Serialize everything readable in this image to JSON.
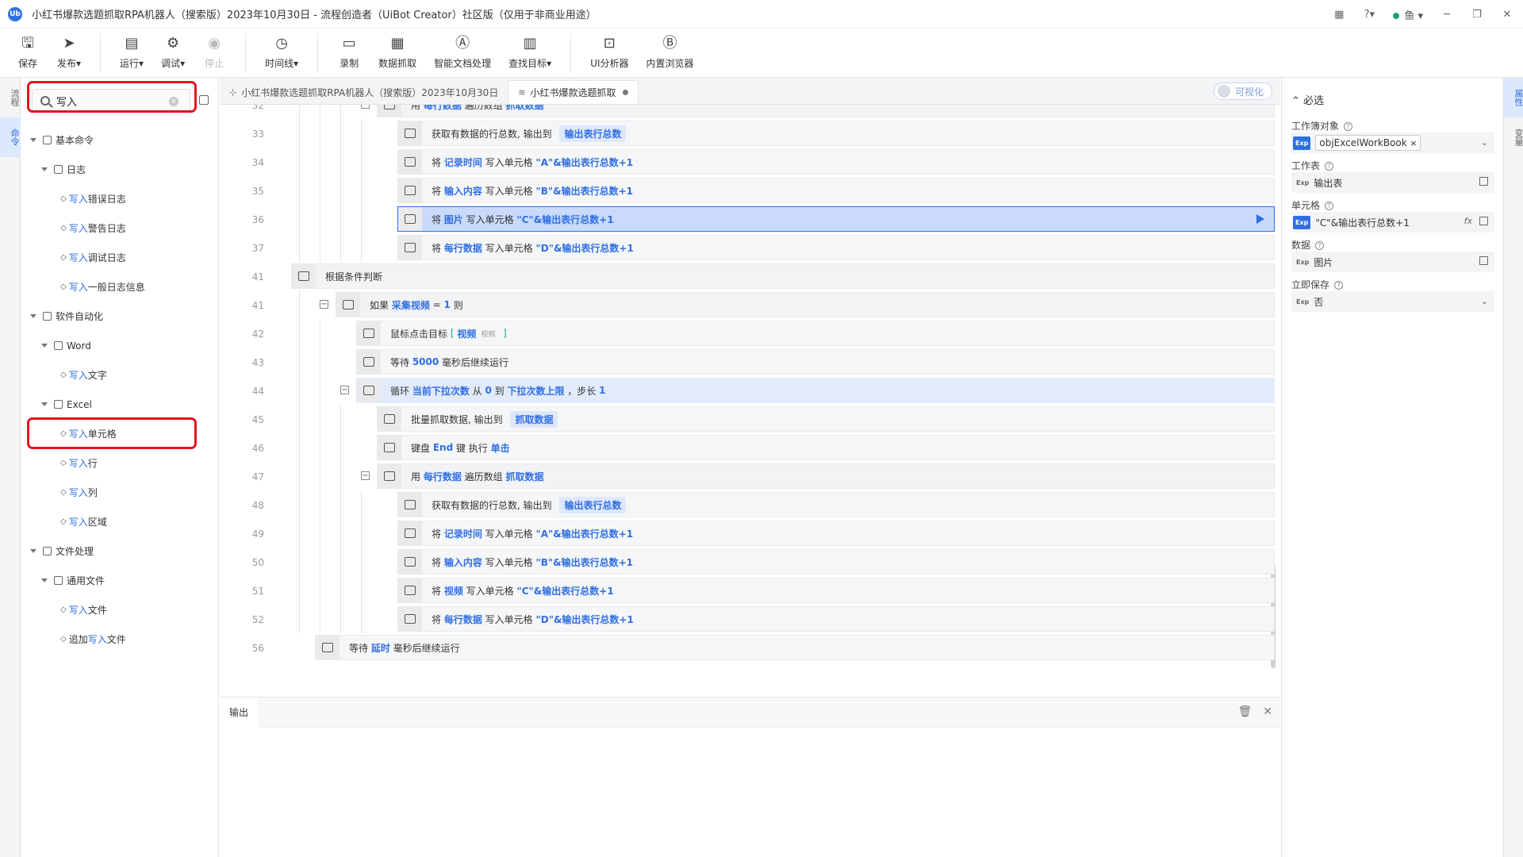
{
  "window": {
    "title": "小红书爆款选题抓取RPA机器人（搜索版）2023年10月30日 - 流程创造者（UiBot Creator）社区版（仅用于非商业用途）",
    "logo": "Ub",
    "user": "鱼",
    "accent": "#2f6fe4"
  },
  "toolbar": {
    "items": [
      {
        "label": "保存",
        "icon": "save-icon"
      },
      {
        "label": "发布▾",
        "icon": "send-icon"
      },
      {
        "label": "运行▾",
        "icon": "run-icon"
      },
      {
        "label": "调试▾",
        "icon": "debug-icon"
      },
      {
        "label": "停止",
        "icon": "stop-icon"
      },
      {
        "label": "时间线▾",
        "icon": "clock-icon"
      },
      {
        "label": "录制",
        "icon": "record-icon"
      },
      {
        "label": "数据抓取",
        "icon": "data-capture-icon"
      },
      {
        "label": "智能文档处理",
        "icon": "ai-doc-icon"
      },
      {
        "label": "查找目标▾",
        "icon": "find-target-icon"
      },
      {
        "label": "UI分析器",
        "icon": "ui-analyzer-icon"
      },
      {
        "label": "内置浏览器",
        "icon": "browser-icon"
      }
    ]
  },
  "left_strip": {
    "tabs": [
      "流程",
      "命令"
    ]
  },
  "right_strip": {
    "tabs": [
      "属性",
      "变量"
    ]
  },
  "commands": {
    "search_value": "写入",
    "tree": [
      {
        "level": 0,
        "label": "基本命令",
        "expand": true
      },
      {
        "level": 1,
        "label": "日志",
        "expand": true
      },
      {
        "level": 2,
        "prefix": "写入",
        "label": "错误日志"
      },
      {
        "level": 2,
        "prefix": "写入",
        "label": "警告日志"
      },
      {
        "level": 2,
        "prefix": "写入",
        "label": "调试日志"
      },
      {
        "level": 2,
        "prefix": "写入",
        "label": "一般日志信息"
      },
      {
        "level": 0,
        "label": "软件自动化",
        "expand": true
      },
      {
        "level": 1,
        "label": "Word",
        "expand": true
      },
      {
        "level": 2,
        "prefix": "写入",
        "label": "文字"
      },
      {
        "level": 1,
        "label": "Excel",
        "expand": true
      },
      {
        "level": 2,
        "prefix": "写入",
        "label": "单元格"
      },
      {
        "level": 2,
        "prefix": "写入",
        "label": "行"
      },
      {
        "level": 2,
        "prefix": "写入",
        "label": "列"
      },
      {
        "level": 2,
        "prefix": "写入",
        "label": "区域"
      },
      {
        "level": 0,
        "label": "文件处理",
        "expand": true
      },
      {
        "level": 1,
        "label": "通用文件",
        "expand": true
      },
      {
        "level": 2,
        "prefix": "写入",
        "label": "文件"
      },
      {
        "level": 2,
        "before": "追加",
        "prefix": "写入",
        "label": "文件"
      }
    ]
  },
  "editor": {
    "tabs": [
      {
        "label": "小红书爆款选题抓取RPA机器人（搜索版）2023年10月30日",
        "icon": "flow-icon"
      },
      {
        "label": "小红书爆款选题抓取",
        "icon": "layers-icon"
      }
    ],
    "visual_toggle": "可视化"
  },
  "code_lines": [
    {
      "num": "32",
      "depth": 3,
      "kind": "block",
      "collapse": true,
      "parts": [
        [
          "t",
          "用 "
        ],
        [
          "v",
          "每行数据"
        ],
        [
          "t",
          " 遍历数组 "
        ],
        [
          "v",
          "抓取数据"
        ]
      ]
    },
    {
      "num": "33",
      "depth": 4,
      "kind": "cmd",
      "parts": [
        [
          "t",
          "获取有数据的行总数, 输出到 "
        ],
        [
          "tag",
          "输出表行总数"
        ]
      ]
    },
    {
      "num": "34",
      "depth": 4,
      "kind": "cmd",
      "parts": [
        [
          "t",
          "将 "
        ],
        [
          "v",
          "记录时间"
        ],
        [
          "t",
          " 写入单元格 "
        ],
        [
          "s",
          "\"A\"&输出表行总数+1"
        ]
      ]
    },
    {
      "num": "35",
      "depth": 4,
      "kind": "cmd",
      "parts": [
        [
          "t",
          "将 "
        ],
        [
          "v",
          "输入内容"
        ],
        [
          "t",
          " 写入单元格 "
        ],
        [
          "s",
          "\"B\"&输出表行总数+1"
        ]
      ]
    },
    {
      "num": "36",
      "depth": 4,
      "kind": "cmd",
      "selected": true,
      "parts": [
        [
          "t",
          "将 "
        ],
        [
          "v",
          "图片"
        ],
        [
          "t",
          " 写入单元格 "
        ],
        [
          "s",
          "\"C\"&输出表行总数+1"
        ]
      ]
    },
    {
      "num": "37",
      "depth": 4,
      "kind": "cmd",
      "parts": [
        [
          "t",
          "将 "
        ],
        [
          "v",
          "每行数据"
        ],
        [
          "t",
          " 写入单元格 "
        ],
        [
          "s",
          "\"D\"&输出表行总数+1"
        ]
      ]
    },
    {
      "num": "41",
      "depth": 0,
      "kind": "block",
      "parts": [
        [
          "t",
          "根据条件判断"
        ]
      ]
    },
    {
      "num": "41",
      "depth": 1,
      "kind": "block",
      "collapse": true,
      "parts": [
        [
          "t",
          "如果 "
        ],
        [
          "v",
          "采集视频"
        ],
        [
          "t",
          " = "
        ],
        [
          "n",
          "1"
        ],
        [
          "t",
          " 则"
        ]
      ]
    },
    {
      "num": "42",
      "depth": 2,
      "kind": "cmd",
      "parts": [
        [
          "t",
          "鼠标点击目标 "
        ],
        [
          "g",
          "[ "
        ],
        [
          "v",
          "视频"
        ],
        [
          "gray",
          "视频"
        ],
        [
          "g",
          " ]"
        ]
      ]
    },
    {
      "num": "43",
      "depth": 2,
      "kind": "cmd",
      "parts": [
        [
          "t",
          "等待 "
        ],
        [
          "n",
          "5000"
        ],
        [
          "t",
          " 毫秒后继续运行"
        ]
      ]
    },
    {
      "num": "44",
      "depth": 2,
      "kind": "block",
      "collapse": true,
      "loop": true,
      "parts": [
        [
          "t",
          "循环 "
        ],
        [
          "v",
          "当前下拉次数"
        ],
        [
          "t",
          " 从 "
        ],
        [
          "n",
          "0"
        ],
        [
          "t",
          " 到 "
        ],
        [
          "v",
          "下拉次数上限"
        ],
        [
          "t",
          " ，步长 "
        ],
        [
          "n",
          "1"
        ]
      ]
    },
    {
      "num": "45",
      "depth": 3,
      "kind": "cmd",
      "parts": [
        [
          "t",
          "批量抓取数据, 输出到 "
        ],
        [
          "tag",
          "抓取数据"
        ]
      ]
    },
    {
      "num": "46",
      "depth": 3,
      "kind": "cmd",
      "parts": [
        [
          "t",
          "键盘 "
        ],
        [
          "v",
          "End"
        ],
        [
          "t",
          " 键 执行 "
        ],
        [
          "v",
          "单击"
        ]
      ]
    },
    {
      "num": "47",
      "depth": 3,
      "kind": "block",
      "collapse": true,
      "parts": [
        [
          "t",
          "用 "
        ],
        [
          "v",
          "每行数据"
        ],
        [
          "t",
          " 遍历数组 "
        ],
        [
          "v",
          "抓取数据"
        ]
      ]
    },
    {
      "num": "48",
      "depth": 4,
      "kind": "cmd",
      "parts": [
        [
          "t",
          "获取有数据的行总数, 输出到 "
        ],
        [
          "tag",
          "输出表行总数"
        ]
      ]
    },
    {
      "num": "49",
      "depth": 4,
      "kind": "cmd",
      "parts": [
        [
          "t",
          "将 "
        ],
        [
          "v",
          "记录时间"
        ],
        [
          "t",
          " 写入单元格 "
        ],
        [
          "s",
          "\"A\"&输出表行总数+1"
        ]
      ]
    },
    {
      "num": "50",
      "depth": 4,
      "kind": "cmd",
      "parts": [
        [
          "t",
          "将 "
        ],
        [
          "v",
          "输入内容"
        ],
        [
          "t",
          " 写入单元格 "
        ],
        [
          "s",
          "\"B\"&输出表行总数+1"
        ]
      ]
    },
    {
      "num": "51",
      "depth": 4,
      "kind": "cmd",
      "parts": [
        [
          "t",
          "将 "
        ],
        [
          "v",
          "视频"
        ],
        [
          "t",
          " 写入单元格 "
        ],
        [
          "s",
          "\"C\"&输出表行总数+1"
        ]
      ]
    },
    {
      "num": "52",
      "depth": 4,
      "kind": "cmd",
      "parts": [
        [
          "t",
          "将 "
        ],
        [
          "v",
          "每行数据"
        ],
        [
          "t",
          " 写入单元格 "
        ],
        [
          "s",
          "\"D\"&输出表行总数+1"
        ]
      ]
    },
    {
      "num": "56",
      "depth": 0,
      "kind": "cmd",
      "parts": [
        [
          "t",
          "等待 "
        ],
        [
          "v",
          "延时"
        ],
        [
          "t",
          " 毫秒后继续运行"
        ]
      ]
    }
  ],
  "output": {
    "tab": "输出"
  },
  "properties": {
    "section": "必选",
    "fields": [
      {
        "label": "工作簿对象",
        "value": "objExcelWorkBook",
        "exp_active": true,
        "chip": true,
        "end": "dropdown"
      },
      {
        "label": "工作表",
        "value": "输出表",
        "exp_active": false,
        "end": "edit"
      },
      {
        "label": "单元格",
        "value": "\"C\"&输出表行总数+1",
        "exp_active": true,
        "end": "fx-edit"
      },
      {
        "label": "数据",
        "value": "图片",
        "exp_active": false,
        "end": "edit"
      },
      {
        "label": "立即保存",
        "value": "否",
        "exp_active": false,
        "end": "dropdown"
      }
    ]
  }
}
